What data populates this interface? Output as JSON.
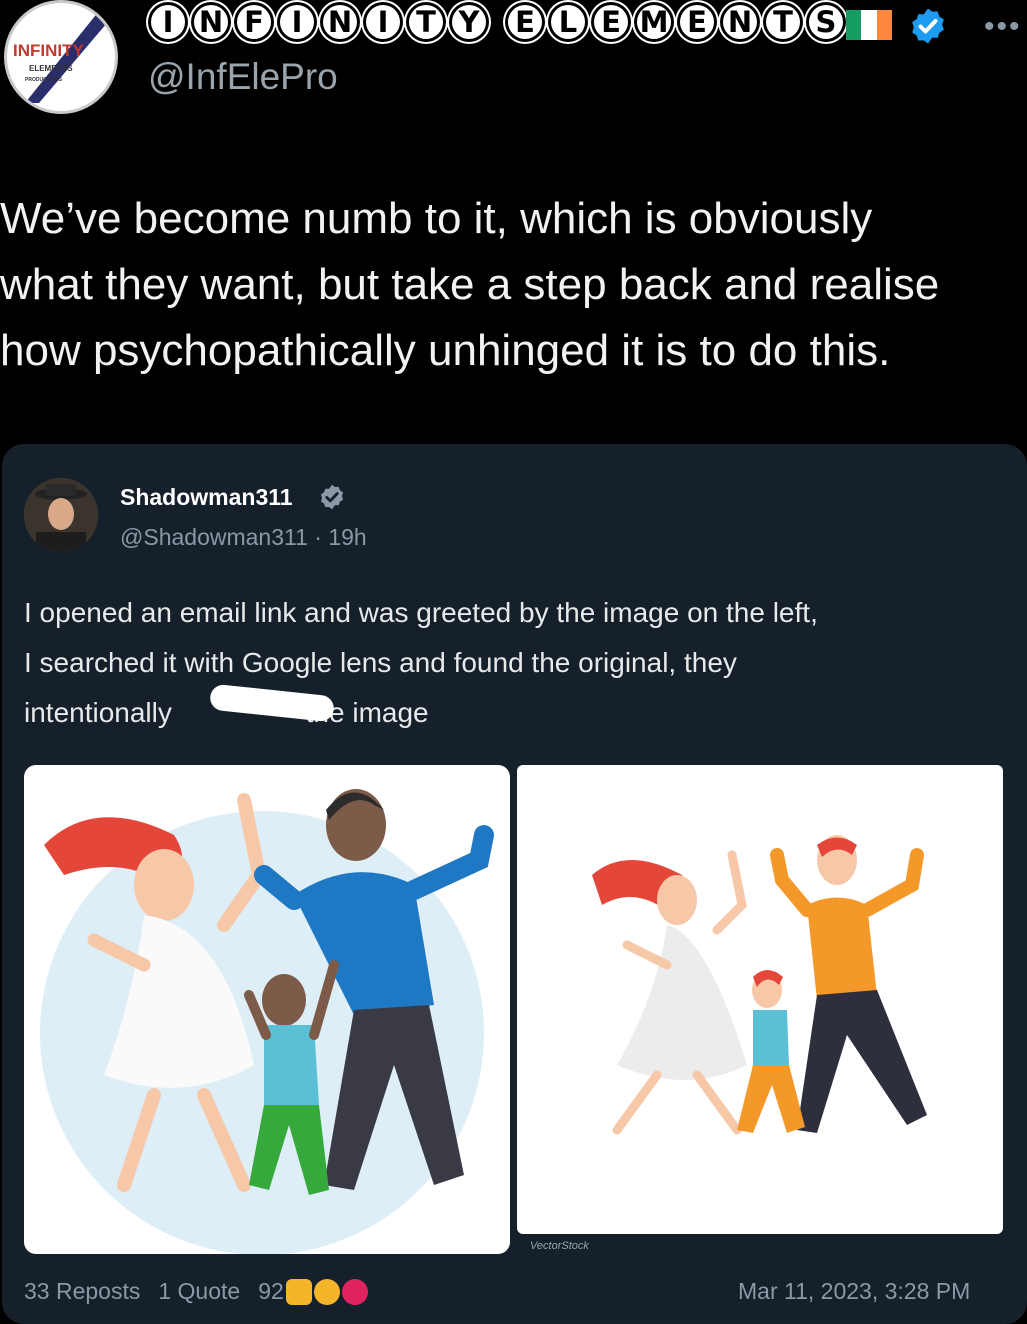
{
  "header": {
    "avatar_text_top": "INFINITY",
    "avatar_text_mid": "ELEMENTS",
    "avatar_text_bottom": "PRODUCTIONS",
    "display_name_letters": [
      "I",
      "N",
      "F",
      "I",
      "N",
      "I",
      "T",
      "Y",
      " ",
      "E",
      "L",
      "E",
      "M",
      "E",
      "N",
      "T",
      "S"
    ],
    "handle": "@InfElePro",
    "flag_colors": [
      "#169b62",
      "#ffffff",
      "#ff883e"
    ],
    "verified_color": "#1d9bf0",
    "more_label": "•••"
  },
  "post": {
    "text": "We’ve become numb to it, which is obviously\nwhat they want, but take a step back and realise\nhow psychopathically unhinged it is to do this."
  },
  "quoted": {
    "name": "Shadowman311",
    "meta": "@Shadowman311 · 19h",
    "text_line1": "I opened an email link and was greeted by the image on the left,",
    "text_line2": "I searched it with Google lens and found the original, they",
    "text_line3_a": "intentionally",
    "text_line3_b": " the image",
    "watermark": "VectorStock"
  },
  "stats": {
    "reposts": "33 Reposts",
    "quote": "1 Quote",
    "reactions": "92",
    "timestamp": "Mar 11, 2023, 3:28 PM"
  }
}
